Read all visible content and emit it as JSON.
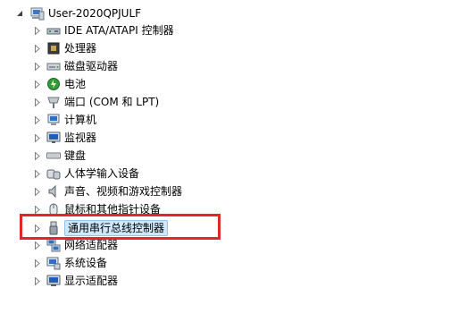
{
  "tree": {
    "root": {
      "label": "User-2020QPJULF",
      "icon": "computer-icon",
      "expanded": true
    },
    "items": [
      {
        "label": "IDE ATA/ATAPI 控制器",
        "icon": "ide-controller-icon"
      },
      {
        "label": "处理器",
        "icon": "processor-icon"
      },
      {
        "label": "磁盘驱动器",
        "icon": "disk-drive-icon"
      },
      {
        "label": "电池",
        "icon": "battery-icon"
      },
      {
        "label": "端口 (COM 和 LPT)",
        "icon": "port-icon"
      },
      {
        "label": "计算机",
        "icon": "computer-icon"
      },
      {
        "label": "监视器",
        "icon": "monitor-icon"
      },
      {
        "label": "键盘",
        "icon": "keyboard-icon"
      },
      {
        "label": "人体学输入设备",
        "icon": "hid-icon"
      },
      {
        "label": "声音、视频和游戏控制器",
        "icon": "sound-icon"
      },
      {
        "label": "鼠标和其他指针设备",
        "icon": "mouse-icon"
      },
      {
        "label": "通用串行总线控制器",
        "icon": "usb-icon",
        "selected": true
      },
      {
        "label": "网络适配器",
        "icon": "network-adapter-icon"
      },
      {
        "label": "系统设备",
        "icon": "system-device-icon"
      },
      {
        "label": "显示适配器",
        "icon": "display-adapter-icon"
      }
    ]
  },
  "colors": {
    "highlight_border": "#e3262a",
    "selection_background": "#cfe8fb"
  }
}
